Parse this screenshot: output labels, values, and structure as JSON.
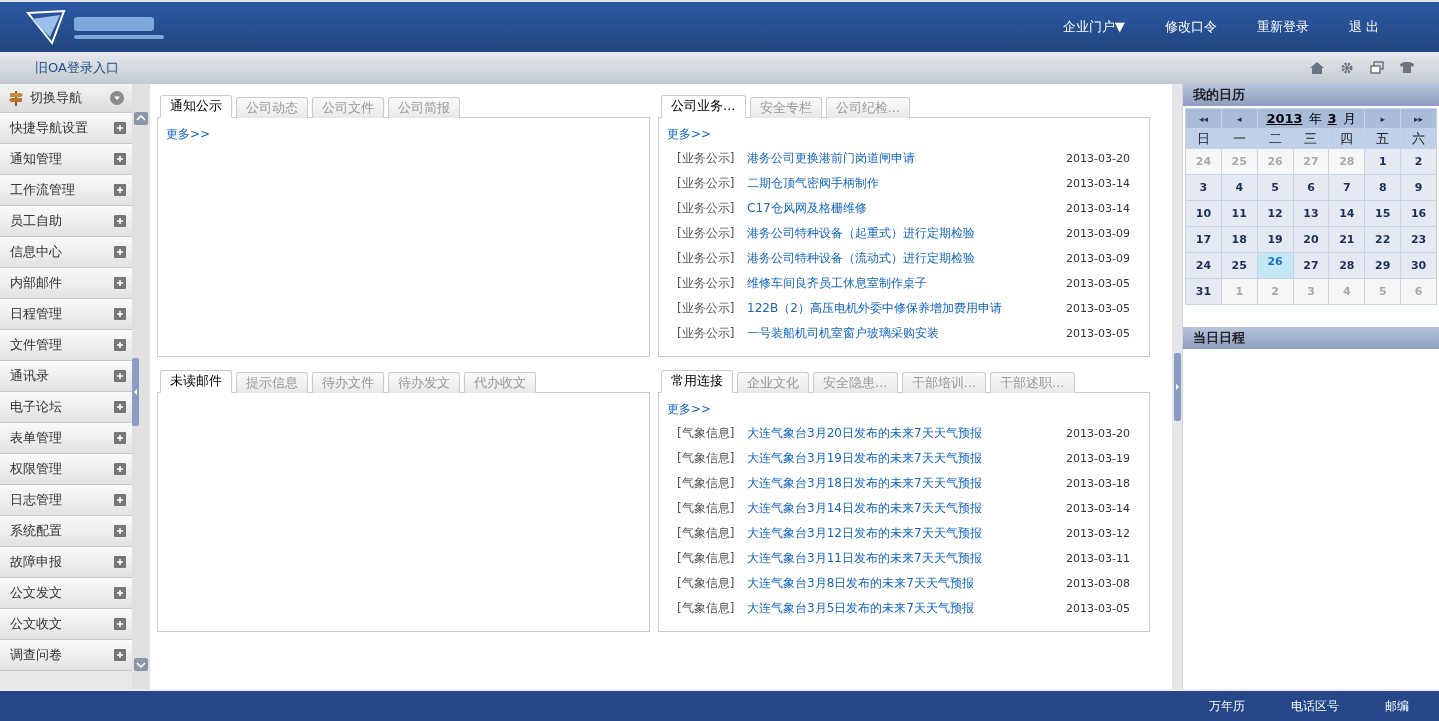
{
  "header": {
    "links": [
      {
        "label": "企业门户▼"
      },
      {
        "label": "修改口令"
      },
      {
        "label": "重新登录"
      },
      {
        "label": "退 出"
      }
    ]
  },
  "subbar": {
    "link": "旧OA登录入口"
  },
  "sidebar": {
    "title": "切换导航",
    "items": [
      "快捷导航设置",
      "通知管理",
      "工作流管理",
      "员工自助",
      "信息中心",
      "内部邮件",
      "日程管理",
      "文件管理",
      "通讯录",
      "电子论坛",
      "表单管理",
      "权限管理",
      "日志管理",
      "系统配置",
      "故障申报",
      "公文发文",
      "公文收文",
      "调查问卷"
    ]
  },
  "panels": [
    {
      "tabs": [
        {
          "label": "通知公示",
          "selected": true
        },
        {
          "label": "公司动态",
          "selected": false
        },
        {
          "label": "公司文件",
          "selected": false
        },
        {
          "label": "公司简报",
          "selected": false
        }
      ],
      "more": "更多>>"
    },
    {
      "tabs": [
        {
          "label": "公司业务…",
          "selected": true
        },
        {
          "label": "安全专栏",
          "selected": false
        },
        {
          "label": "公司纪检…",
          "selected": false
        }
      ],
      "more": "更多>>",
      "rows": [
        {
          "category": "[业务公示]",
          "title": "港务公司更换港前门岗道闸申请",
          "date": "2013-03-20"
        },
        {
          "category": "[业务公示]",
          "title": "二期仓顶气密阀手柄制作",
          "date": "2013-03-14"
        },
        {
          "category": "[业务公示]",
          "title": "C17仓风网及格栅维修",
          "date": "2013-03-14"
        },
        {
          "category": "[业务公示]",
          "title": "港务公司特种设备（起重式）进行定期检验",
          "date": "2013-03-09"
        },
        {
          "category": "[业务公示]",
          "title": "港务公司特种设备（流动式）进行定期检验",
          "date": "2013-03-09"
        },
        {
          "category": "[业务公示]",
          "title": "维修车间良齐员工休息室制作桌子",
          "date": "2013-03-05"
        },
        {
          "category": "[业务公示]",
          "title": "122B（2）高压电机外委中修保养增加费用申请",
          "date": "2013-03-05"
        },
        {
          "category": "[业务公示]",
          "title": "一号装船机司机室窗户玻璃采购安装",
          "date": "2013-03-05"
        }
      ]
    },
    {
      "tabs": [
        {
          "label": "未读邮件",
          "selected": true
        },
        {
          "label": "提示信息",
          "selected": false
        },
        {
          "label": "待办文件",
          "selected": false
        },
        {
          "label": "待办发文",
          "selected": false
        },
        {
          "label": "代办收文",
          "selected": false
        }
      ]
    },
    {
      "tabs": [
        {
          "label": "常用连接",
          "selected": true
        },
        {
          "label": "企业文化",
          "selected": false
        },
        {
          "label": "安全隐患…",
          "selected": false
        },
        {
          "label": "干部培训…",
          "selected": false
        },
        {
          "label": "干部述职…",
          "selected": false
        }
      ],
      "more": "更多>>",
      "rows": [
        {
          "category": "[气象信息]",
          "title": "大连气象台3月20日发布的未来7天天气预报",
          "date": "2013-03-20"
        },
        {
          "category": "[气象信息]",
          "title": "大连气象台3月19日发布的未来7天天气预报",
          "date": "2013-03-19"
        },
        {
          "category": "[气象信息]",
          "title": "大连气象台3月18日发布的未来7天天气预报",
          "date": "2013-03-18"
        },
        {
          "category": "[气象信息]",
          "title": "大连气象台3月14日发布的未来7天天气预报",
          "date": "2013-03-14"
        },
        {
          "category": "[气象信息]",
          "title": "大连气象台3月12日发布的未来7天天气预报",
          "date": "2013-03-12"
        },
        {
          "category": "[气象信息]",
          "title": "大连气象台3月11日发布的未来7天天气预报",
          "date": "2013-03-11"
        },
        {
          "category": "[气象信息]",
          "title": "大连气象台3月8日发布的未来7天天气预报",
          "date": "2013-03-08"
        },
        {
          "category": "[气象信息]",
          "title": "大连气象台3月5日发布的未来7天天气预报",
          "date": "2013-03-05"
        }
      ]
    }
  ],
  "calendar": {
    "title": "我的日历",
    "nav": [
      "◂◂",
      "◂",
      "▸",
      "▸▸"
    ],
    "year": "2013",
    "year_unit": "年",
    "month": "3",
    "month_unit": "月",
    "weekdays": [
      "日",
      "一",
      "二",
      "三",
      "四",
      "五",
      "六"
    ],
    "days": [
      {
        "label": "24",
        "kind": "other",
        "selected": false
      },
      {
        "label": "25",
        "kind": "other",
        "selected": false
      },
      {
        "label": "26",
        "kind": "other",
        "selected": false
      },
      {
        "label": "27",
        "kind": "other",
        "selected": false
      },
      {
        "label": "28",
        "kind": "other",
        "selected": false
      },
      {
        "label": "1",
        "kind": "current",
        "selected": false
      },
      {
        "label": "2",
        "kind": "current",
        "selected": false
      },
      {
        "label": "3",
        "kind": "current",
        "selected": false
      },
      {
        "label": "4",
        "kind": "current",
        "selected": false
      },
      {
        "label": "5",
        "kind": "current",
        "selected": false
      },
      {
        "label": "6",
        "kind": "current",
        "selected": false
      },
      {
        "label": "7",
        "kind": "current",
        "selected": false
      },
      {
        "label": "8",
        "kind": "current",
        "selected": false
      },
      {
        "label": "9",
        "kind": "current",
        "selected": false
      },
      {
        "label": "10",
        "kind": "current",
        "selected": false
      },
      {
        "label": "11",
        "kind": "current",
        "selected": false
      },
      {
        "label": "12",
        "kind": "current",
        "selected": false
      },
      {
        "label": "13",
        "kind": "current",
        "selected": false
      },
      {
        "label": "14",
        "kind": "current",
        "selected": false
      },
      {
        "label": "15",
        "kind": "current",
        "selected": false
      },
      {
        "label": "16",
        "kind": "current",
        "selected": false
      },
      {
        "label": "17",
        "kind": "current",
        "selected": false
      },
      {
        "label": "18",
        "kind": "current",
        "selected": false
      },
      {
        "label": "19",
        "kind": "current",
        "selected": false
      },
      {
        "label": "20",
        "kind": "current",
        "selected": false
      },
      {
        "label": "21",
        "kind": "current",
        "selected": false
      },
      {
        "label": "22",
        "kind": "current",
        "selected": false
      },
      {
        "label": "23",
        "kind": "current",
        "selected": false
      },
      {
        "label": "24",
        "kind": "current",
        "selected": false
      },
      {
        "label": "25",
        "kind": "current",
        "selected": false
      },
      {
        "label": "26",
        "kind": "current",
        "selected": true
      },
      {
        "label": "27",
        "kind": "current",
        "selected": false
      },
      {
        "label": "28",
        "kind": "current",
        "selected": false
      },
      {
        "label": "29",
        "kind": "current",
        "selected": false
      },
      {
        "label": "30",
        "kind": "current",
        "selected": false
      },
      {
        "label": "31",
        "kind": "current",
        "selected": false
      },
      {
        "label": "1",
        "kind": "other",
        "selected": false
      },
      {
        "label": "2",
        "kind": "other",
        "selected": false
      },
      {
        "label": "3",
        "kind": "other",
        "selected": false
      },
      {
        "label": "4",
        "kind": "other",
        "selected": false
      },
      {
        "label": "5",
        "kind": "other",
        "selected": false
      },
      {
        "label": "6",
        "kind": "other",
        "selected": false
      }
    ]
  },
  "schedule": {
    "title": "当日日程"
  },
  "footer": {
    "links": [
      "万年历",
      "电话区号",
      "邮编"
    ]
  }
}
